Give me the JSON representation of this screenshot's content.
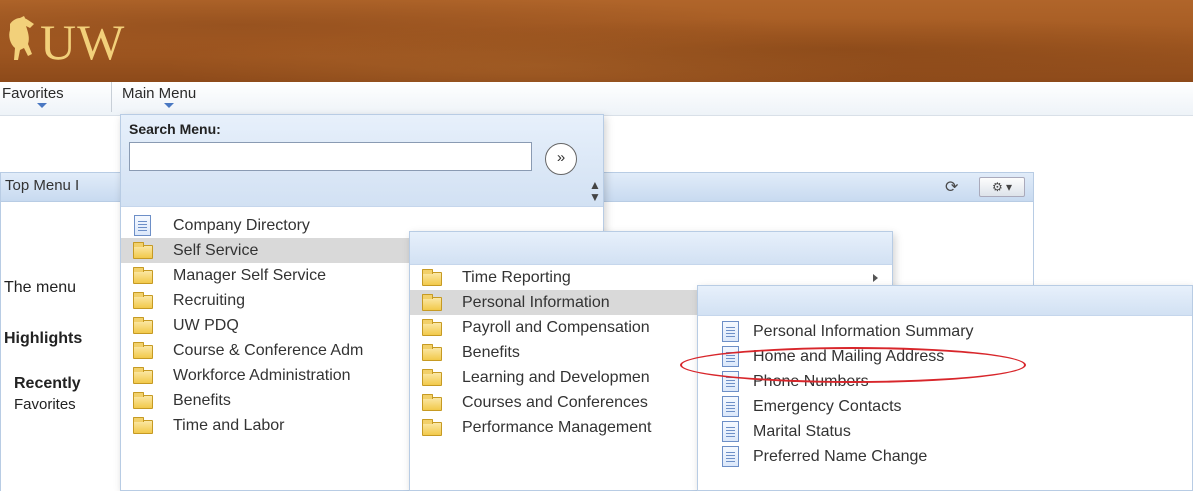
{
  "header": {
    "logo_text": "UW",
    "brand_color": "#a45a22",
    "logo_color": "#f2d07a"
  },
  "nav": {
    "favorites_label": "Favorites",
    "main_menu_label": "Main Menu"
  },
  "search": {
    "label": "Search Menu:",
    "value": "",
    "go_glyph": "»"
  },
  "page": {
    "top_menu_title": "Top Menu I",
    "menu_text": "The menu",
    "highlights_text": "Highlights",
    "recently_text": "Recently",
    "favorites_text": "Favorites"
  },
  "main_menu": {
    "items": [
      {
        "label": "Company Directory",
        "icon": "document-icon"
      },
      {
        "label": "Self Service",
        "icon": "folder-icon",
        "active": true
      },
      {
        "label": "Manager Self Service",
        "icon": "folder-icon"
      },
      {
        "label": "Recruiting",
        "icon": "folder-icon"
      },
      {
        "label": "UW PDQ",
        "icon": "folder-icon"
      },
      {
        "label": "Course & Conference Adm",
        "icon": "folder-icon"
      },
      {
        "label": "Workforce Administration",
        "icon": "folder-icon"
      },
      {
        "label": "Benefits",
        "icon": "folder-icon"
      },
      {
        "label": "Time and Labor",
        "icon": "folder-icon"
      }
    ]
  },
  "self_service_menu": {
    "items": [
      {
        "label": "Time Reporting",
        "icon": "folder-icon",
        "has_submenu": true
      },
      {
        "label": "Personal Information",
        "icon": "folder-icon",
        "active": true
      },
      {
        "label": "Payroll and Compensation",
        "icon": "folder-icon"
      },
      {
        "label": "Benefits",
        "icon": "folder-icon"
      },
      {
        "label": "Learning and Developmen",
        "icon": "folder-icon"
      },
      {
        "label": "Courses and Conferences",
        "icon": "folder-icon"
      },
      {
        "label": "Performance Management",
        "icon": "folder-icon"
      }
    ]
  },
  "personal_info_menu": {
    "items": [
      {
        "label": "Personal Information Summary",
        "icon": "document-icon"
      },
      {
        "label": "Home and Mailing Address",
        "icon": "document-icon",
        "highlighted": true
      },
      {
        "label": "Phone Numbers",
        "icon": "document-icon"
      },
      {
        "label": "Emergency Contacts",
        "icon": "document-icon"
      },
      {
        "label": "Marital Status",
        "icon": "document-icon"
      },
      {
        "label": "Preferred Name Change",
        "icon": "document-icon"
      }
    ]
  },
  "colors": {
    "panel_header": "#d2e1f3",
    "active_row": "#d9d9d9",
    "highlight_circle": "#d8262b"
  }
}
